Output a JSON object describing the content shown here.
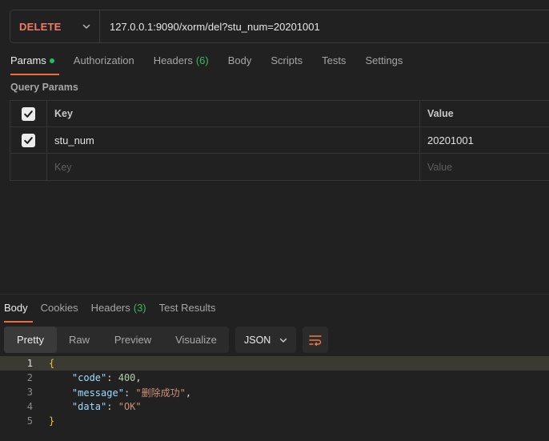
{
  "request": {
    "method": "DELETE",
    "url": "127.0.0.1:9090/xorm/del?stu_num=20201001"
  },
  "request_tabs": [
    {
      "label": "Params",
      "count": ""
    },
    {
      "label": "Authorization",
      "count": ""
    },
    {
      "label": "Headers",
      "count": "(6)"
    },
    {
      "label": "Body",
      "count": ""
    },
    {
      "label": "Scripts",
      "count": ""
    },
    {
      "label": "Tests",
      "count": ""
    },
    {
      "label": "Settings",
      "count": ""
    }
  ],
  "query_params": {
    "title": "Query Params",
    "headers": {
      "key": "Key",
      "value": "Value"
    },
    "rows": [
      {
        "checked": true,
        "key": "stu_num",
        "value": "20201001"
      }
    ],
    "placeholder": {
      "key": "Key",
      "value": "Value"
    }
  },
  "response_tabs": [
    {
      "label": "Body",
      "count": ""
    },
    {
      "label": "Cookies",
      "count": ""
    },
    {
      "label": "Headers",
      "count": "(3)"
    },
    {
      "label": "Test Results",
      "count": ""
    }
  ],
  "format_buttons": [
    "Pretty",
    "Raw",
    "Preview",
    "Visualize"
  ],
  "format_select": "JSON",
  "code": {
    "line_numbers": [
      "1",
      "2",
      "3",
      "4",
      "5"
    ],
    "open_brace": "{",
    "close_brace": "}",
    "fields": [
      {
        "key": "\"code\"",
        "value": "400",
        "type": "number",
        "comma": ","
      },
      {
        "key": "\"message\"",
        "value": "\"删除成功\"",
        "type": "string",
        "comma": ","
      },
      {
        "key": "\"data\"",
        "value": "\"OK\"",
        "type": "string",
        "comma": ""
      }
    ]
  },
  "colors": {
    "method": "#f07b68",
    "active_tab_underline": "#f26b3a",
    "params_dot": "#1fbf60",
    "count": "#3fb65f"
  }
}
